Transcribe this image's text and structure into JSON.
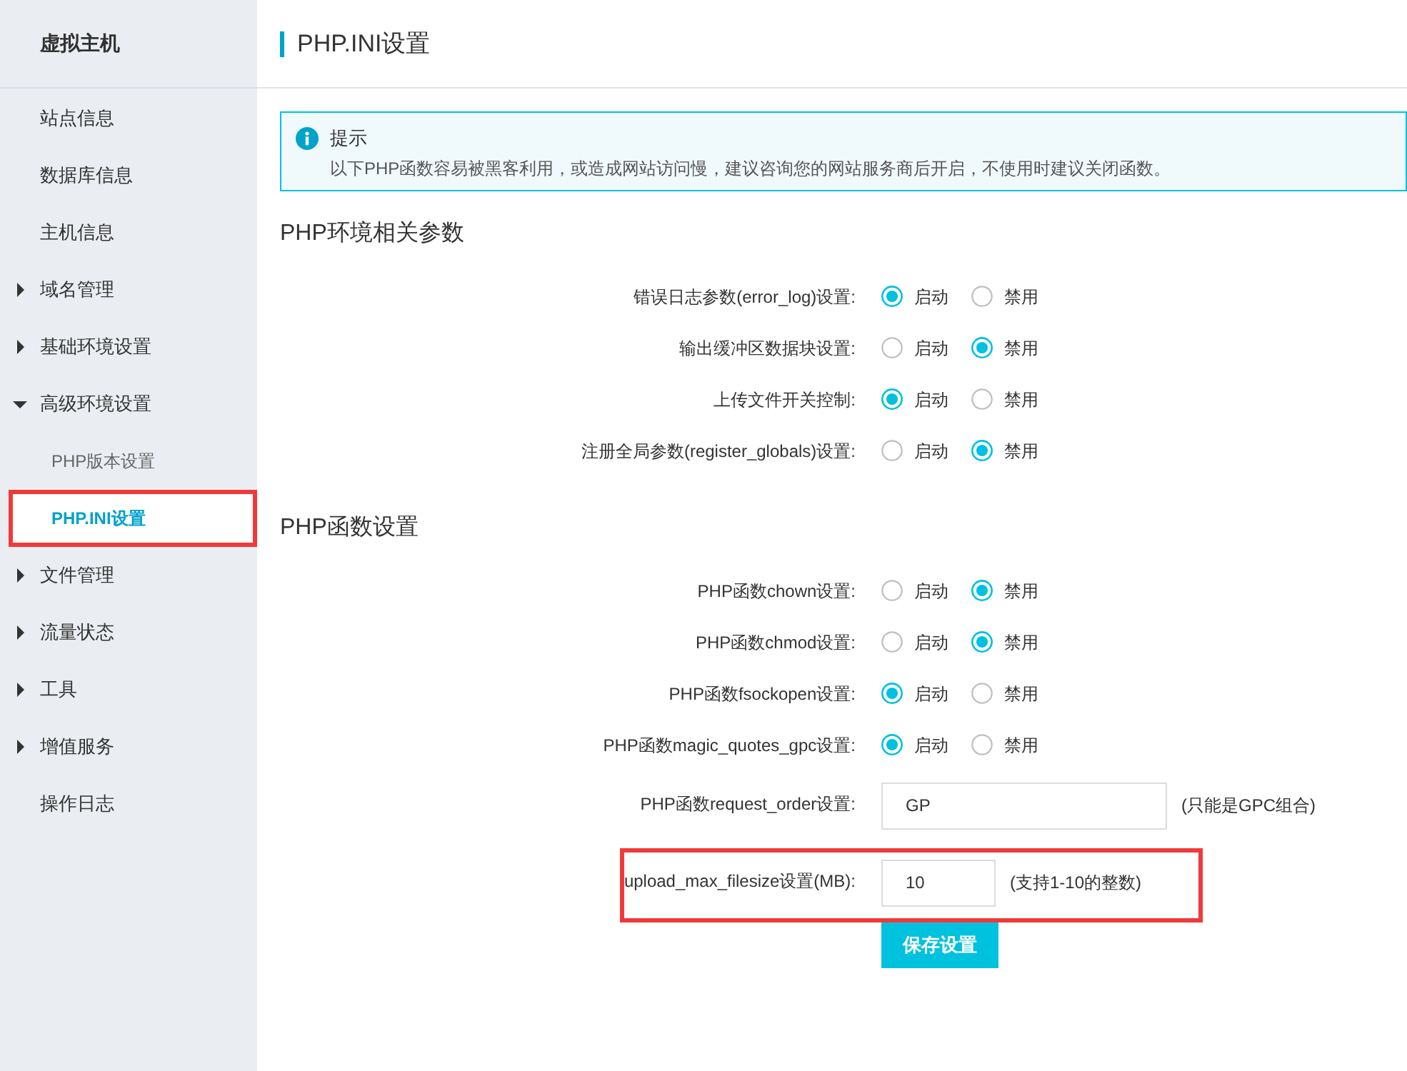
{
  "sidebar": {
    "title": "虚拟主机",
    "items": [
      {
        "label": "站点信息",
        "kind": "link"
      },
      {
        "label": "数据库信息",
        "kind": "link"
      },
      {
        "label": "主机信息",
        "kind": "link"
      },
      {
        "label": "域名管理",
        "kind": "group",
        "expanded": false
      },
      {
        "label": "基础环境设置",
        "kind": "group",
        "expanded": false
      },
      {
        "label": "高级环境设置",
        "kind": "group",
        "expanded": true,
        "children": [
          {
            "label": "PHP版本设置",
            "selected": false,
            "highlighted": false
          },
          {
            "label": "PHP.INI设置",
            "selected": true,
            "highlighted": true
          }
        ]
      },
      {
        "label": "文件管理",
        "kind": "group",
        "expanded": false
      },
      {
        "label": "流量状态",
        "kind": "group",
        "expanded": false
      },
      {
        "label": "工具",
        "kind": "group",
        "expanded": false
      },
      {
        "label": "增值服务",
        "kind": "group",
        "expanded": false
      },
      {
        "label": "操作日志",
        "kind": "link"
      }
    ]
  },
  "page_title": "PHP.INI设置",
  "notice": {
    "title": "提示",
    "text": "以下PHP函数容易被黑客利用，或造成网站访问慢，建议咨询您的网站服务商后开启，不使用时建议关闭函数。"
  },
  "sections": [
    {
      "title": "PHP环境相关参数",
      "rows": [
        {
          "kind": "radio",
          "label": "错误日志参数(error_log)设置:",
          "options": [
            {
              "label": "启动",
              "selected": true
            },
            {
              "label": "禁用",
              "selected": false
            }
          ]
        },
        {
          "kind": "radio",
          "label": "输出缓冲区数据块设置:",
          "options": [
            {
              "label": "启动",
              "selected": false
            },
            {
              "label": "禁用",
              "selected": true
            }
          ]
        },
        {
          "kind": "radio",
          "label": "上传文件开关控制:",
          "options": [
            {
              "label": "启动",
              "selected": true
            },
            {
              "label": "禁用",
              "selected": false
            }
          ]
        },
        {
          "kind": "radio",
          "label": "注册全局参数(register_globals)设置:",
          "options": [
            {
              "label": "启动",
              "selected": false
            },
            {
              "label": "禁用",
              "selected": true
            }
          ]
        }
      ]
    },
    {
      "title": "PHP函数设置",
      "rows": [
        {
          "kind": "radio",
          "label": "PHP函数chown设置:",
          "options": [
            {
              "label": "启动",
              "selected": false
            },
            {
              "label": "禁用",
              "selected": true
            }
          ]
        },
        {
          "kind": "radio",
          "label": "PHP函数chmod设置:",
          "options": [
            {
              "label": "启动",
              "selected": false
            },
            {
              "label": "禁用",
              "selected": true
            }
          ]
        },
        {
          "kind": "radio",
          "label": "PHP函数fsockopen设置:",
          "options": [
            {
              "label": "启动",
              "selected": true
            },
            {
              "label": "禁用",
              "selected": false
            }
          ]
        },
        {
          "kind": "radio",
          "label": "PHP函数magic_quotes_gpc设置:",
          "options": [
            {
              "label": "启动",
              "selected": true
            },
            {
              "label": "禁用",
              "selected": false
            }
          ]
        },
        {
          "kind": "wide_text",
          "label": "PHP函数request_order设置:",
          "value": "GP",
          "hint": "(只能是GPC组合)",
          "highlighted": false
        },
        {
          "kind": "short_text",
          "label": "upload_max_filesize设置(MB):",
          "value": "10",
          "hint": "(支持1-10的整数)",
          "highlighted": true
        }
      ]
    }
  ],
  "save_button": "保存设置"
}
